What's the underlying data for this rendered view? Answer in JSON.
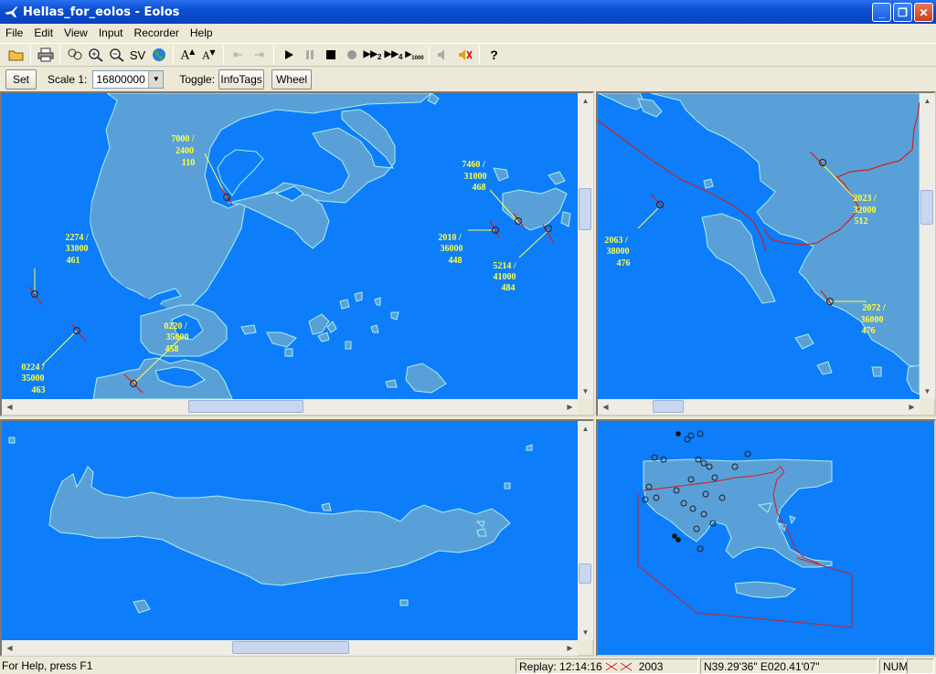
{
  "window": {
    "title": "Hellas_for_eolos - Eolos"
  },
  "menu": [
    "File",
    "Edit",
    "View",
    "Input",
    "Recorder",
    "Help"
  ],
  "toolbar": {
    "sv_label": "SV",
    "icons": [
      "open-icon",
      "print-icon",
      "zoom-fit-icon",
      "zoom-in-icon",
      "zoom-out-icon",
      "sv-button",
      "globe-icon",
      "font-larger-icon",
      "font-smaller-icon",
      "disabled-arrow-left-icon",
      "disabled-arrow-right-icon",
      "play-icon",
      "pause-icon",
      "stop-icon",
      "record-icon",
      "speed-x2-icon",
      "speed-x4-icon",
      "speed-x1000-icon",
      "volume-icon",
      "mute-icon",
      "help-icon"
    ]
  },
  "toolbar2": {
    "set_label": "Set",
    "scale_label": "Scale 1:",
    "scale_value": "16800000",
    "toggle_label": "Toggle:",
    "infotags_label": "InfoTags",
    "wheel_label": "Wheel"
  },
  "map1": {
    "tags": [
      {
        "l1": "7000 /",
        "l2": "2400",
        "l3": "110"
      },
      {
        "l1": "7460 /",
        "l2": "31000",
        "l3": "468"
      },
      {
        "l1": "2274 /",
        "l2": "33000",
        "l3": "461"
      },
      {
        "l1": "2010 /",
        "l2": "36000",
        "l3": "448"
      },
      {
        "l1": "5214 /",
        "l2": "41000",
        "l3": "484"
      },
      {
        "l1": "0220 /",
        "l2": "35000",
        "l3": "458"
      },
      {
        "l1": "0224 /",
        "l2": "35000",
        "l3": "463"
      }
    ]
  },
  "map2": {
    "tags": [
      {
        "l1": "2063 /",
        "l2": "38000",
        "l3": "476"
      },
      {
        "l1": "2023 /",
        "l2": "32000",
        "l3": "512"
      },
      {
        "l1": "2072 /",
        "l2": "36000",
        "l3": "476"
      }
    ]
  },
  "status": {
    "help": "For Help, press F1",
    "replay": "Replay: 12:14:16",
    "year": "2003",
    "coords": "N39.29'36\" E020.41'07\"",
    "num": "NUM"
  },
  "colors": {
    "sea": "#0d7dfa",
    "land": "#5aa0d8",
    "coast": "#a8f0f0",
    "border": "#d02020",
    "tag": "#ffff40"
  }
}
